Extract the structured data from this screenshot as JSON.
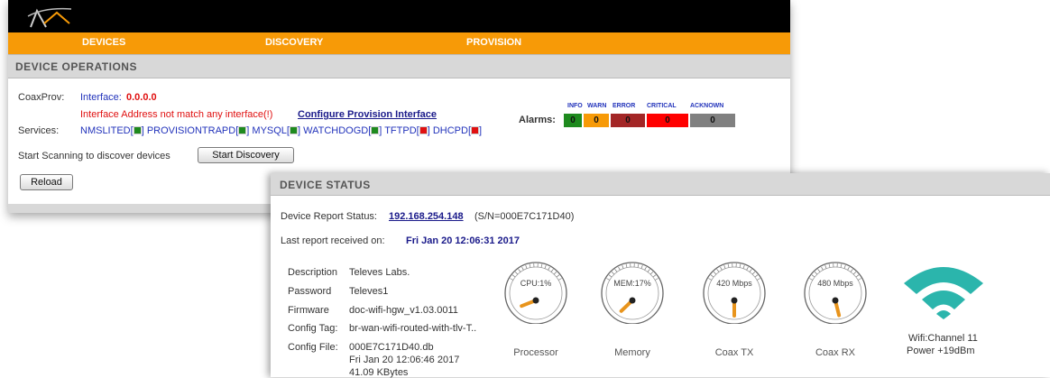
{
  "nav": {
    "items": [
      "DEVICES",
      "DISCOVERY",
      "PROVISION"
    ]
  },
  "device_operations": {
    "title": "DEVICE OPERATIONS",
    "coaxprov_label": "CoaxProv:",
    "interface_label": "Interface:",
    "interface_value": "0.0.0.0",
    "warning_text": "Interface Address not match any interface(!)",
    "configure_link": "Configure Provision Interface",
    "services_label": "Services:",
    "services": [
      {
        "name": "NMSLITED",
        "status": "green"
      },
      {
        "name": "PROVISIONTRAPD",
        "status": "green"
      },
      {
        "name": "MYSQL",
        "status": "green"
      },
      {
        "name": "WATCHDOGD",
        "status": "green"
      },
      {
        "name": "TFTPD",
        "status": "red"
      },
      {
        "name": "DHCPD",
        "status": "red"
      }
    ],
    "scan_label": "Start Scanning to discover devices",
    "start_discovery_button": "Start Discovery",
    "reload_button": "Reload",
    "alarms_label": "Alarms:",
    "alarms": [
      {
        "label": "INFO",
        "value": "0",
        "color": "#1e8a1e"
      },
      {
        "label": "WARN",
        "value": "0",
        "color": "#f79a07"
      },
      {
        "label": "ERROR",
        "value": "0",
        "color": "#a32626"
      },
      {
        "label": "CRITICAL",
        "value": "0",
        "color": "#ff0000"
      },
      {
        "label": "ACKNOWN",
        "value": "0",
        "color": "#808080"
      }
    ]
  },
  "device_status": {
    "title": "DEVICE STATUS",
    "report_label": "Device Report Status:",
    "report_ip": "192.168.254.148",
    "report_sn": "(S/N=000E7C171D40)",
    "last_report_label": "Last report received on:",
    "last_report_value": "Fri Jan 20 12:06:31 2017",
    "info": {
      "description_label": "Description",
      "description_value": "Televes Labs.",
      "password_label": "Password",
      "password_value": "Televes1",
      "firmware_label": "Firmware",
      "firmware_value": "doc-wifi-hgw_v1.03.0011",
      "config_tag_label": "Config Tag:",
      "config_tag_value": "br-wan-wifi-routed-with-tlv-T..",
      "config_file_label": "Config File:",
      "config_file_name": "000E7C171D40.db",
      "config_file_date": "Fri Jan 20 12:06:46 2017",
      "config_file_size": "41.09 KBytes"
    },
    "gauges": [
      {
        "label": "Processor",
        "reading": "CPU:1%",
        "level": 0.01
      },
      {
        "label": "Memory",
        "reading": "MEM:17%",
        "level": 0.17
      },
      {
        "label": "Coax TX",
        "reading": "420 Mbps",
        "level": 0.5
      },
      {
        "label": "Coax RX",
        "reading": "480 Mbps",
        "level": 0.6
      }
    ],
    "wifi": {
      "channel": "Wifi:Channel 11",
      "power": "Power +19dBm",
      "color": "#2bb5ac"
    }
  }
}
